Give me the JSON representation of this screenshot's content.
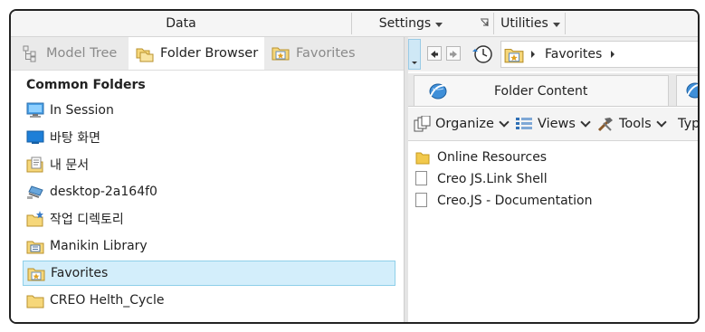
{
  "ribbon": {
    "data_label": "Data",
    "settings_label": "Settings",
    "utilities_label": "Utilities"
  },
  "left_panel": {
    "tabs": [
      {
        "label": "Model Tree",
        "icon": "model-tree-icon"
      },
      {
        "label": "Folder Browser",
        "icon": "folder-browser-icon"
      },
      {
        "label": "Favorites",
        "icon": "favorites-icon"
      }
    ],
    "active_tab": "Folder Browser",
    "section_title": "Common Folders",
    "items": [
      {
        "label": "In Session",
        "icon": "monitor-icon"
      },
      {
        "label": "바탕 화면",
        "icon": "desktop-icon"
      },
      {
        "label": "내 문서",
        "icon": "documents-icon"
      },
      {
        "label": "desktop-2a164f0",
        "icon": "network-computer-icon"
      },
      {
        "label": "작업 디렉토리",
        "icon": "working-directory-icon"
      },
      {
        "label": "Manikin Library",
        "icon": "library-folder-icon"
      },
      {
        "label": "Favorites",
        "icon": "favorites-folder-icon",
        "selected": true
      },
      {
        "label": "CREO Helth_Cycle",
        "icon": "folder-icon"
      }
    ]
  },
  "right_panel": {
    "path": {
      "current": "Favorites"
    },
    "content_tab_label": "Folder Content",
    "toolbar": {
      "organize_label": "Organize",
      "views_label": "Views",
      "tools_label": "Tools",
      "type_label": "Typ"
    },
    "files": [
      {
        "label": "Online Resources",
        "icon": "folder-icon"
      },
      {
        "label": "Creo JS.Link Shell",
        "icon": "document-icon"
      },
      {
        "label": "Creo.JS - Documentation",
        "icon": "document-icon"
      }
    ]
  },
  "colors": {
    "selection_bg": "#d3eefb",
    "selection_border": "#8ecfe9",
    "folder_yellow": "#f2c94c"
  }
}
